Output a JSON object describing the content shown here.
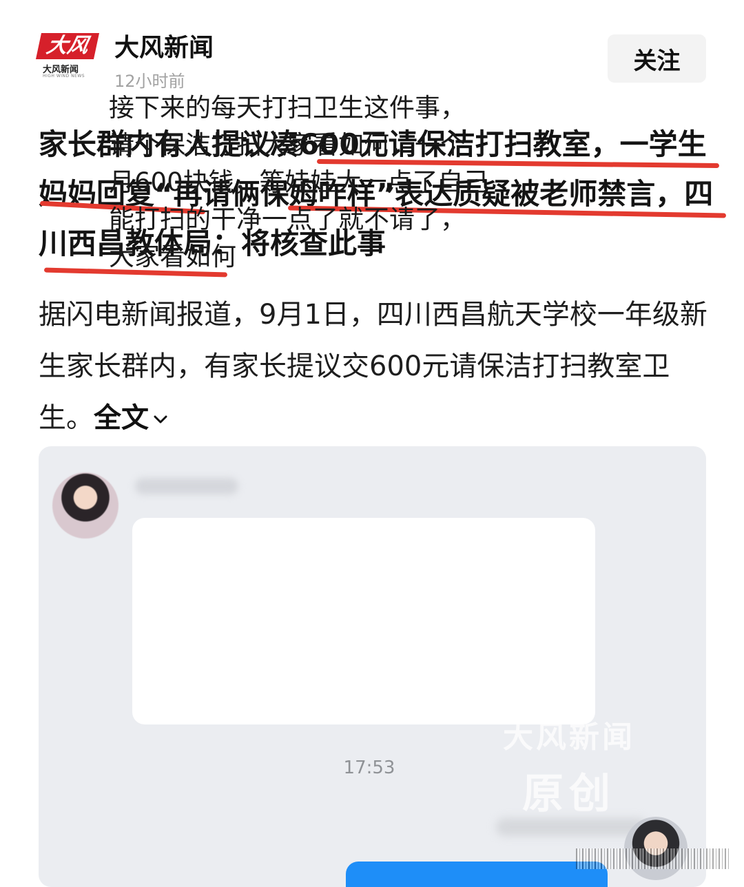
{
  "header": {
    "logo_mark": "大风",
    "logo_cn": "大风新闻",
    "logo_en": "HIGH WIND NEWS",
    "source_name": "大风新闻",
    "post_time": "12小时前",
    "follow_label": "关注"
  },
  "headline": "家长群内有人提议凑600元请保洁打扫教室，一学生妈妈回复“再请俩保姆咋样”表达质疑被老师禁言，四川西昌教体局：将核查此事",
  "summary": {
    "text": "据闪电新闻报道，9月1日，四川西昌航天学校一年级新生家长群内，有家长提议交600元请保洁打扫教室卫生。",
    "expand_label": "全文"
  },
  "chat": {
    "message": "接下来的每天打扫卫生这件事，\n请个保洁打扫大家看如何，一个\n月600块钱，等娃娃大一点了自己\n能打扫的干净一点了就不请了，\n大家看如何",
    "time": "17:53",
    "watermark_line1": "大风新闻",
    "watermark_line2": "原创"
  },
  "colors": {
    "annotation_red": "#e33a2f",
    "brand_red": "#d6202a",
    "chat_background": "#ebedf1",
    "sent_bubble": "#1e8ef8"
  },
  "icons": [
    "chevron-down-icon"
  ]
}
